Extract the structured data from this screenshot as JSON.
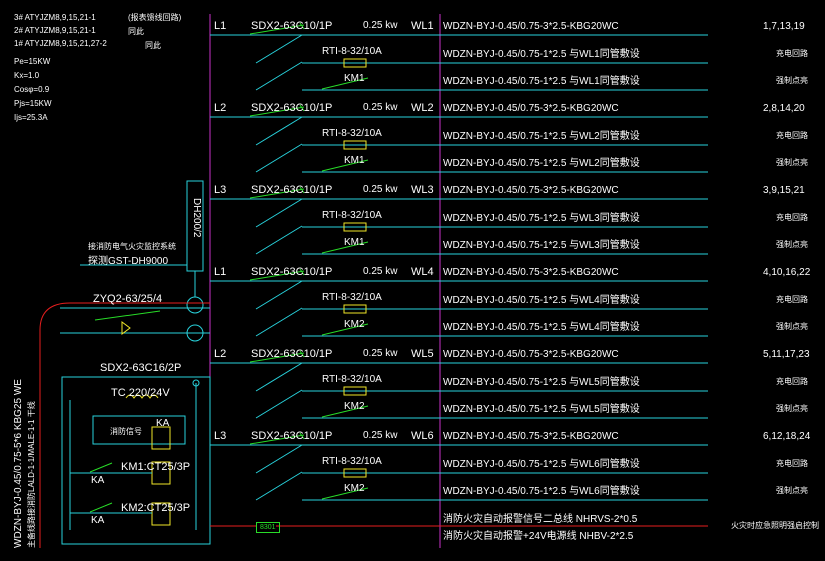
{
  "header": {
    "sources": [
      "3# ATYJZM8,9,15,21-1",
      "2# ATYJZM8,9,15,21-1",
      "1# ATYJZM8,9,15,21,27-2"
    ],
    "annotation": "(报表馈线回路)",
    "annotation_sub1": "同此",
    "annotation_sub2": "同此",
    "params": [
      "Pe=15KW",
      "Kx=1.0",
      "Cosφ=0.9",
      "Pjs=15KW",
      "Ijs=25.3A"
    ]
  },
  "left": {
    "fire_alarm_label": "接消防电气火灾监控系统",
    "fire_alarm_device": "探测GST-DH9000",
    "dh_box": "DH200/2",
    "zyq": "ZYQ2-63/25/4",
    "sdx_main": "SDX2-63C16/2P",
    "tc": "TC 220/24V",
    "fire_signal": "消防信号",
    "ka_box": "KA",
    "km1": "KM1:CT25/3P",
    "km2": "KM2:CT25/3P",
    "ka1": "KA",
    "ka2": "KA",
    "feeder_vertical": "WDZN-BYJ-0.45/0.75-5*6 KBG25 WE",
    "feeder_vertical2": "主备线路接消防LALD-1-1/MALE-1-1 干线"
  },
  "circuits": [
    {
      "phase": "L1",
      "breaker": "SDX2-63C10/1P",
      "power": "0.25 kw",
      "id": "WL1",
      "rti": "RTI-8-32/10A",
      "km": "KM1",
      "cables": [
        "WDZN-BYJ-0.45/0.75-3*2.5-KBG20WC",
        "WDZN-BYJ-0.45/0.75-1*2.5 与WL1同管敷设",
        "WDZN-BYJ-0.45/0.75-1*2.5 与WL1同管敷设"
      ],
      "notes": [
        "1,7,13,19",
        "充电回路",
        "强制点亮"
      ]
    },
    {
      "phase": "L2",
      "breaker": "SDX2-63C10/1P",
      "power": "0.25 kw",
      "id": "WL2",
      "rti": "RTI-8-32/10A",
      "km": "KM1",
      "cables": [
        "WDZN-BYJ-0.45/0.75-3*2.5-KBG20WC",
        "WDZN-BYJ-0.45/0.75-1*2.5 与WL2同管敷设",
        "WDZN-BYJ-0.45/0.75-1*2.5 与WL2同管敷设"
      ],
      "notes": [
        "2,8,14,20",
        "充电回路",
        "强制点亮"
      ]
    },
    {
      "phase": "L3",
      "breaker": "SDX2-63C10/1P",
      "power": "0.25 kw",
      "id": "WL3",
      "rti": "RTI-8-32/10A",
      "km": "KM1",
      "cables": [
        "WDZN-BYJ-0.45/0.75-3*2.5-KBG20WC",
        "WDZN-BYJ-0.45/0.75-1*2.5 与WL3同管敷设",
        "WDZN-BYJ-0.45/0.75-1*2.5 与WL3同管敷设"
      ],
      "notes": [
        "3,9,15,21",
        "充电回路",
        "强制点亮"
      ]
    },
    {
      "phase": "L1",
      "breaker": "SDX2-63C10/1P",
      "power": "0.25 kw",
      "id": "WL4",
      "rti": "RTI-8-32/10A",
      "km": "KM2",
      "cables": [
        "WDZN-BYJ-0.45/0.75-3*2.5-KBG20WC",
        "WDZN-BYJ-0.45/0.75-1*2.5 与WL4同管敷设",
        "WDZN-BYJ-0.45/0.75-1*2.5 与WL4同管敷设"
      ],
      "notes": [
        "4,10,16,22",
        "充电回路",
        "强制点亮"
      ]
    },
    {
      "phase": "L2",
      "breaker": "SDX2-63C10/1P",
      "power": "0.25 kw",
      "id": "WL5",
      "rti": "RTI-8-32/10A",
      "km": "KM2",
      "cables": [
        "WDZN-BYJ-0.45/0.75-3*2.5-KBG20WC",
        "WDZN-BYJ-0.45/0.75-1*2.5 与WL5同管敷设",
        "WDZN-BYJ-0.45/0.75-1*2.5 与WL5同管敷设"
      ],
      "notes": [
        "5,11,17,23",
        "充电回路",
        "强制点亮"
      ]
    },
    {
      "phase": "L3",
      "breaker": "SDX2-63C10/1P",
      "power": "0.25 kw",
      "id": "WL6",
      "rti": "RTI-8-32/10A",
      "km": "KM2",
      "cables": [
        "WDZN-BYJ-0.45/0.75-3*2.5-KBG20WC",
        "WDZN-BYJ-0.45/0.75-1*2.5 与WL6同管敷设",
        "WDZN-BYJ-0.45/0.75-1*2.5 与WL6同管敷设"
      ],
      "notes": [
        "6,12,18,24",
        "充电回路",
        "强制点亮"
      ]
    }
  ],
  "bottom": {
    "tag": "8301",
    "line1": "消防火灾自动报警信号二总线 NHRVS-2*0.5",
    "line2": "消防火灾自动报警+24V电源线 NHBV-2*2.5",
    "right": "火灾时应急照明强启控制"
  },
  "colors": {
    "bus_magenta": "#c832c8",
    "wire_cyan": "#28d2dc",
    "switch_green": "#28dc28",
    "red": "#e61e1e",
    "text": "#ffffff",
    "yellow": "#f0e628"
  }
}
